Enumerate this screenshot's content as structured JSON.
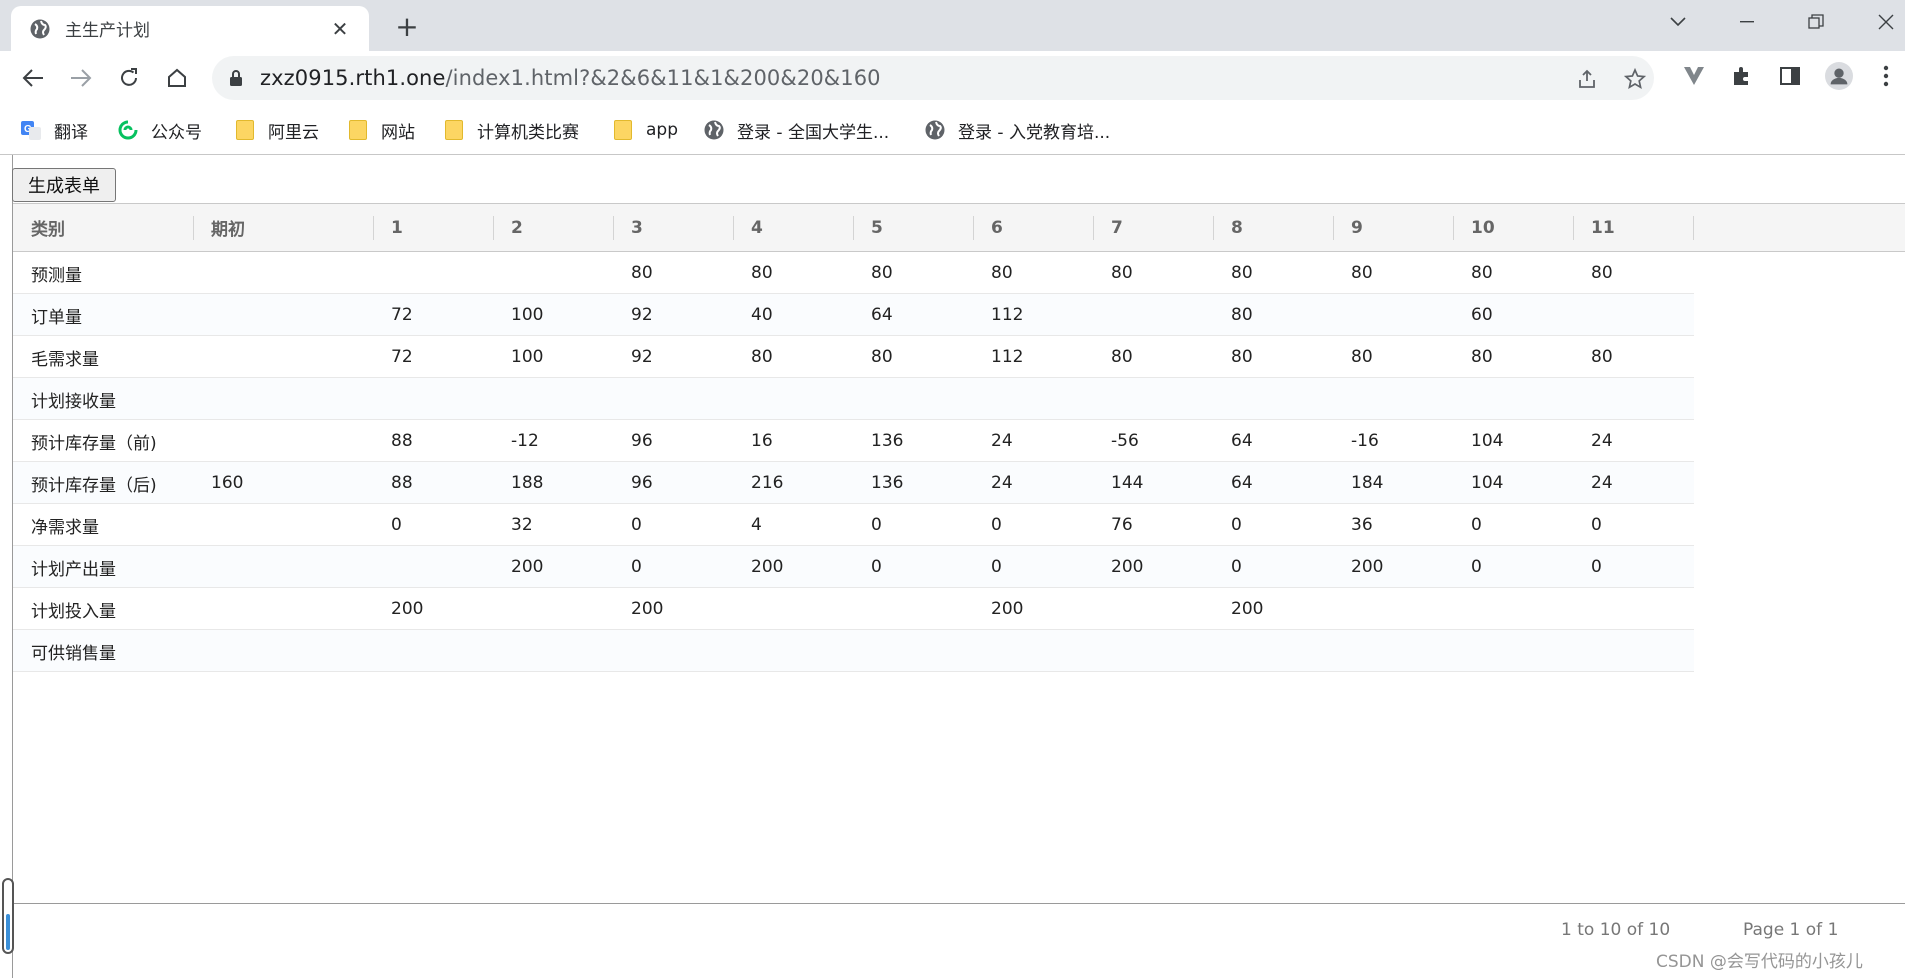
{
  "browser": {
    "tab_title": "主生产计划",
    "url_host": "zxz0915.rth1.one",
    "url_path": "/index1.html?&2&6&11&1&200&20&160",
    "bookmarks": [
      {
        "label": "翻译",
        "icon": "translate-icon"
      },
      {
        "label": "公众号",
        "icon": "wechat-icon"
      },
      {
        "label": "阿里云",
        "icon": "folder-icon"
      },
      {
        "label": "网站",
        "icon": "folder-icon"
      },
      {
        "label": "计算机类比赛",
        "icon": "folder-icon"
      },
      {
        "label": "app",
        "icon": "folder-icon"
      },
      {
        "label": "登录 - 全国大学生...",
        "icon": "globe-icon"
      },
      {
        "label": "登录 - 入党教育培...",
        "icon": "globe-icon"
      }
    ]
  },
  "page": {
    "generate_button": "生成表单",
    "table": {
      "columns": [
        "类别",
        "期初",
        "1",
        "2",
        "3",
        "4",
        "5",
        "6",
        "7",
        "8",
        "9",
        "10",
        "11"
      ],
      "rows": [
        [
          "预测量",
          "",
          "",
          "",
          "80",
          "80",
          "80",
          "80",
          "80",
          "80",
          "80",
          "80",
          "80"
        ],
        [
          "订单量",
          "",
          "72",
          "100",
          "92",
          "40",
          "64",
          "112",
          "",
          "80",
          "",
          "60",
          ""
        ],
        [
          "毛需求量",
          "",
          "72",
          "100",
          "92",
          "80",
          "80",
          "112",
          "80",
          "80",
          "80",
          "80",
          "80"
        ],
        [
          "计划接收量",
          "",
          "",
          "",
          "",
          "",
          "",
          "",
          "",
          "",
          "",
          "",
          ""
        ],
        [
          "预计库存量（前)",
          "",
          "88",
          "-12",
          "96",
          "16",
          "136",
          "24",
          "-56",
          "64",
          "-16",
          "104",
          "24"
        ],
        [
          "预计库存量（后)",
          "160",
          "88",
          "188",
          "96",
          "216",
          "136",
          "24",
          "144",
          "64",
          "184",
          "104",
          "24"
        ],
        [
          "净需求量",
          "",
          "0",
          "32",
          "0",
          "4",
          "0",
          "0",
          "76",
          "0",
          "36",
          "0",
          "0"
        ],
        [
          "计划产出量",
          "",
          "",
          "200",
          "0",
          "200",
          "0",
          "0",
          "200",
          "0",
          "200",
          "0",
          "0"
        ],
        [
          "计划投入量",
          "",
          "200",
          "",
          "200",
          "",
          "",
          "200",
          "",
          "200",
          "",
          "",
          ""
        ],
        [
          "可供销售量",
          "",
          "",
          "",
          "",
          "",
          "",
          "",
          "",
          "",
          "",
          "",
          ""
        ]
      ]
    },
    "pager": {
      "range_text": "1 to 10 of 10",
      "page_text": "Page 1 of 1"
    }
  },
  "watermark": "CSDN @会写代码的小孩儿"
}
